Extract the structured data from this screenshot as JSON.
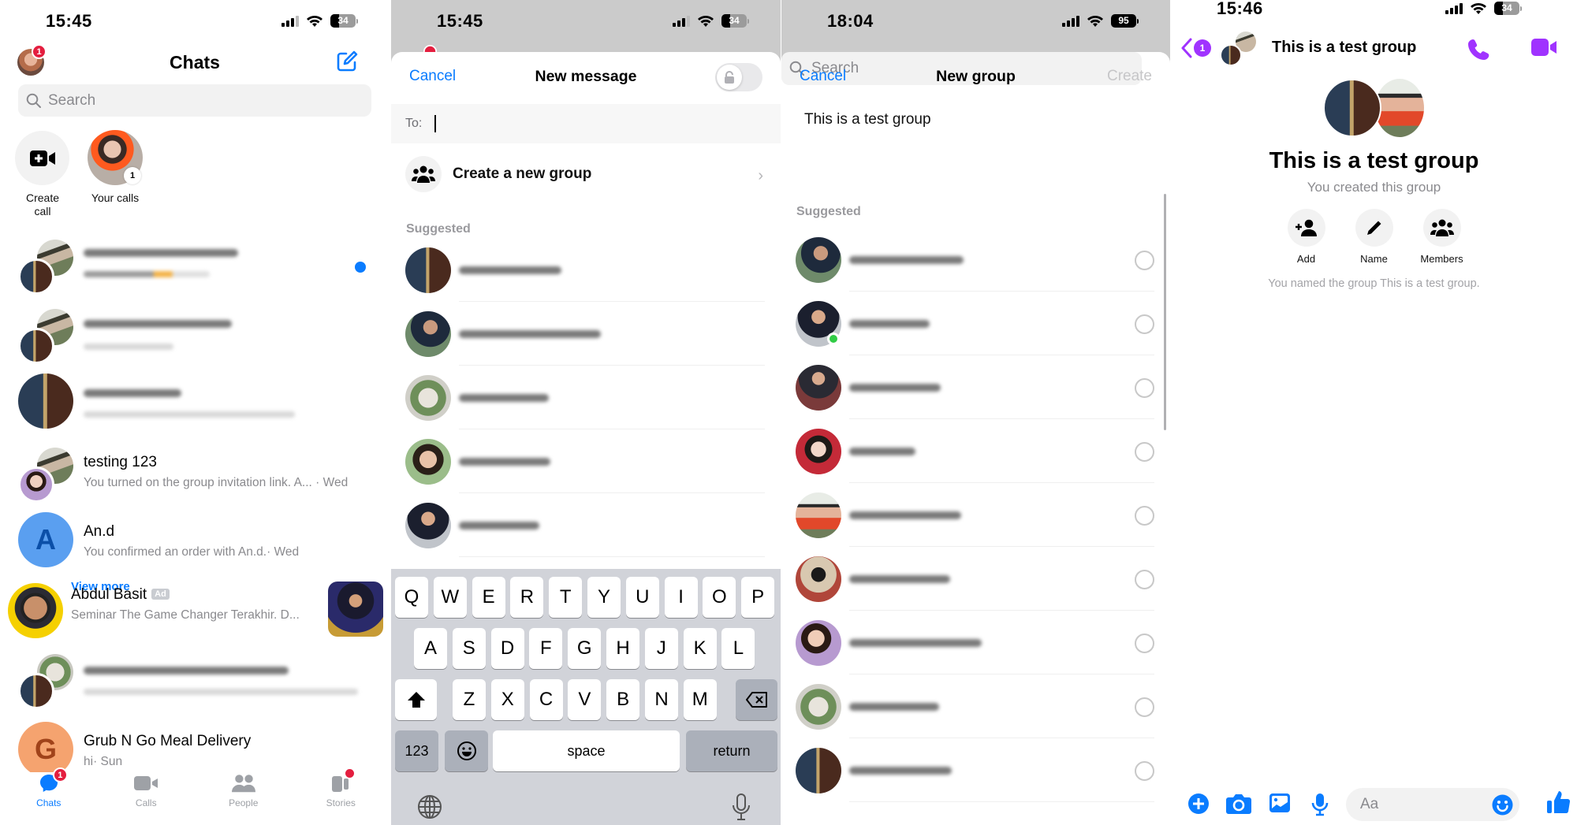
{
  "panels": {
    "chats": {
      "status": {
        "time": "15:45",
        "battery": "34"
      },
      "profile_badge": "1",
      "title": "Chats",
      "search_placeholder": "Search",
      "quick_actions": [
        {
          "label_line1": "Create",
          "label_line2": "call"
        },
        {
          "label": "Your calls",
          "badge": "1"
        }
      ],
      "conversations": [
        {
          "name": "[blurred]",
          "preview": "[blurred]",
          "unread": true
        },
        {
          "name": "[blurred]",
          "preview": "[blurred]"
        },
        {
          "name": "[blurred]",
          "preview": "[blurred]"
        },
        {
          "name": "testing 123",
          "preview": "You turned on the group invitation link. A... · Wed"
        },
        {
          "name": "An.d",
          "avatar_letter": "A",
          "preview": "You confirmed an order with An.d.· Wed"
        },
        {
          "name": "Abdul Basit",
          "tag": "Ad",
          "overlay_link": "View more",
          "preview": "Seminar The Game Changer Terakhir. D..."
        },
        {
          "name": "[blurred]",
          "preview": "[blurred]"
        },
        {
          "name": "Grub N Go Meal Delivery",
          "avatar_letter": "G",
          "preview": "hi· Sun"
        }
      ],
      "tabs": [
        {
          "label": "Chats",
          "badge": "1",
          "active": true
        },
        {
          "label": "Calls"
        },
        {
          "label": "People"
        },
        {
          "label": "Stories",
          "dot": true
        }
      ]
    },
    "new_message": {
      "status": {
        "time": "15:45",
        "battery": "34"
      },
      "cancel": "Cancel",
      "title": "New message",
      "to_label": "To:",
      "to_value": "",
      "create_group": "Create a new group",
      "section": "Suggested",
      "suggested_count": 5,
      "keyboard": {
        "row1": [
          "Q",
          "W",
          "E",
          "R",
          "T",
          "Y",
          "U",
          "I",
          "O",
          "P"
        ],
        "row2": [
          "A",
          "S",
          "D",
          "F",
          "G",
          "H",
          "J",
          "K",
          "L"
        ],
        "row3": [
          "Z",
          "X",
          "C",
          "V",
          "B",
          "N",
          "M"
        ],
        "numbers": "123",
        "space": "space",
        "return": "return"
      }
    },
    "new_group": {
      "status": {
        "time": "18:04",
        "battery": "95"
      },
      "cancel": "Cancel",
      "title": "New group",
      "create": "Create",
      "group_name": "This is a test group",
      "search_placeholder": "Search",
      "section": "Suggested",
      "contacts_count": 9,
      "online_index": 1
    },
    "group_chat": {
      "status": {
        "time": "15:46",
        "battery": "34"
      },
      "back_badge": "1",
      "header_title": "This is a test group",
      "name": "This is a test group",
      "subtitle": "You created this group",
      "actions": [
        {
          "label": "Add"
        },
        {
          "label": "Name"
        },
        {
          "label": "Members"
        }
      ],
      "event_note": "You named the group This is a test group.",
      "composer_placeholder": "Aa"
    }
  },
  "colors": {
    "messenger_blue": "#0a7cff",
    "accent_purple": "#a033ff",
    "badge_red": "#e41e3f",
    "online_green": "#31cc46"
  }
}
